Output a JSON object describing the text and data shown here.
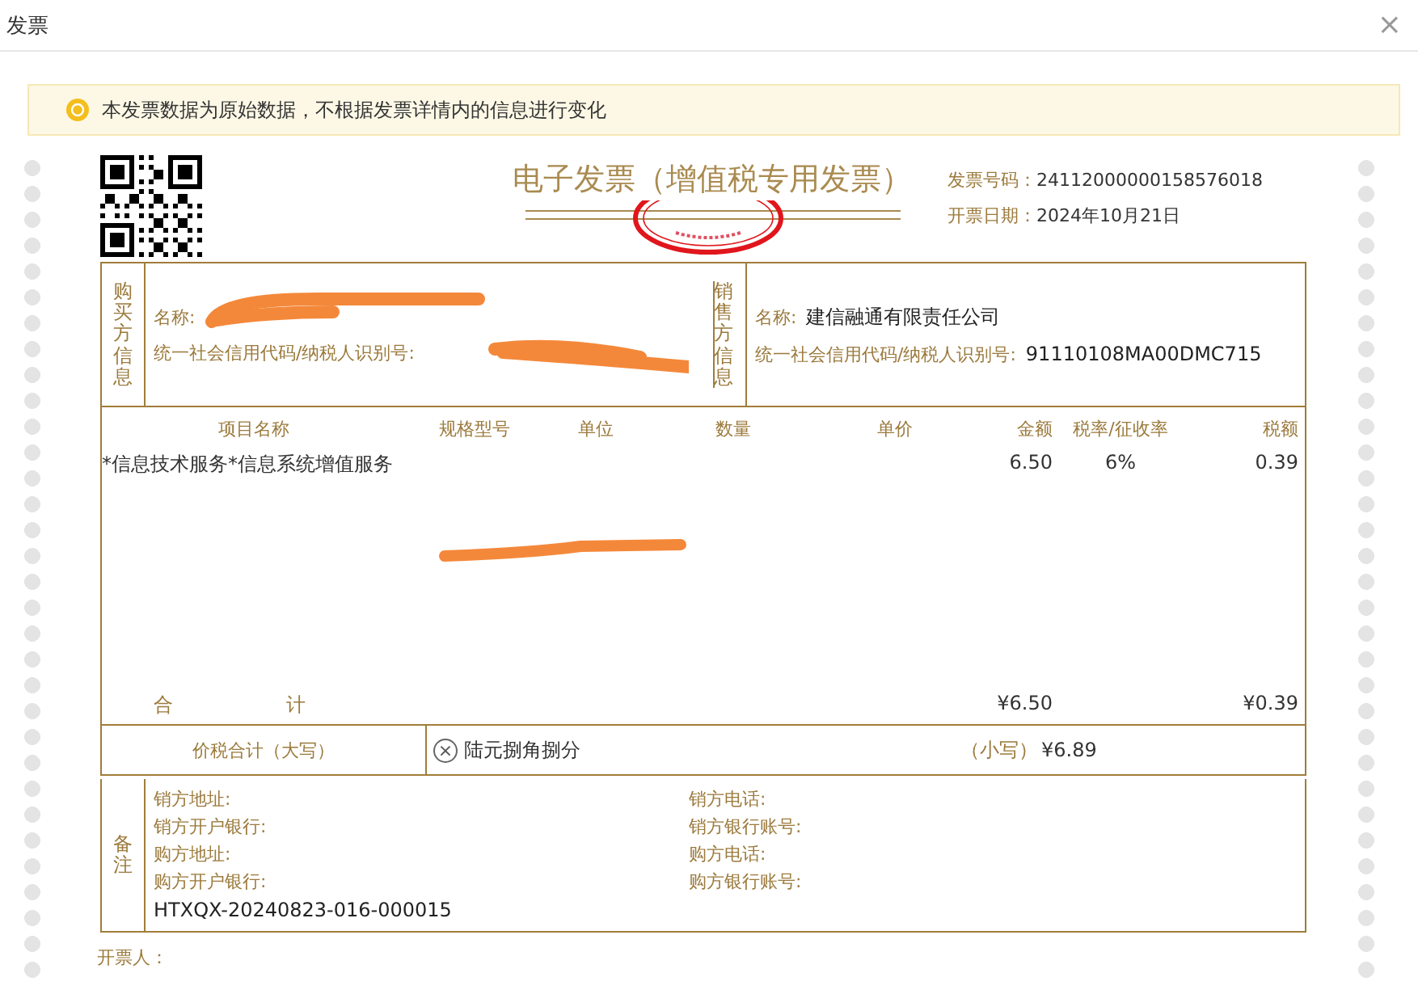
{
  "dialog": {
    "title": "发票",
    "close": "×"
  },
  "notice": {
    "text": "本发票数据为原始数据，不根据发票详情内的信息进行变化"
  },
  "invoice": {
    "title": "电子发票（增值税专用发票）",
    "stamped": true,
    "meta": [
      {
        "label": "发票号码：",
        "value": "24112000000158576018"
      },
      {
        "label": "开票日期：",
        "value": "2024年10月21日"
      }
    ],
    "buyer": {
      "heading": "购买方信息",
      "redacted": true,
      "fields": [
        {
          "label": "名称:"
        },
        {
          "label": "统一社会信用代码/纳税人识别号:"
        }
      ]
    },
    "seller": {
      "heading": "销售方信息",
      "fields": [
        {
          "label": "名称:",
          "value": "建信融通有限责任公司"
        },
        {
          "label": "统一社会信用代码/纳税人识别号:",
          "value": "91110108MA00DMC715"
        }
      ]
    },
    "items": {
      "redacted": true,
      "columns": [
        "项目名称",
        "规格型号",
        "单位",
        "数量",
        "单价",
        "金额",
        "税率/征收率",
        "税额"
      ],
      "rows": [
        {
          "name": "*信息技术服务*信息系统增值服务",
          "amount": "6.50",
          "tax_rate": "6%",
          "tax": "0.39"
        }
      ],
      "total": {
        "label": [
          "合",
          "计"
        ],
        "amount": "¥6.50",
        "tax": "¥0.39"
      }
    },
    "grand_total": {
      "label": "价税合计（大写）",
      "icon": "×",
      "words": "陆元捌角捌分",
      "small_label": "（小写）",
      "small_value": "¥6.89"
    },
    "remarks": {
      "heading": "备注",
      "left": [
        "销方地址:",
        "销方开户银行:",
        "购方地址:",
        "购方开户银行:"
      ],
      "right": [
        "销方电话:",
        "销方银行账号:",
        "购方电话:",
        "购方银行账号:"
      ],
      "note": "HTXQX-20240823-016-000015"
    },
    "issuer": "开票人："
  }
}
